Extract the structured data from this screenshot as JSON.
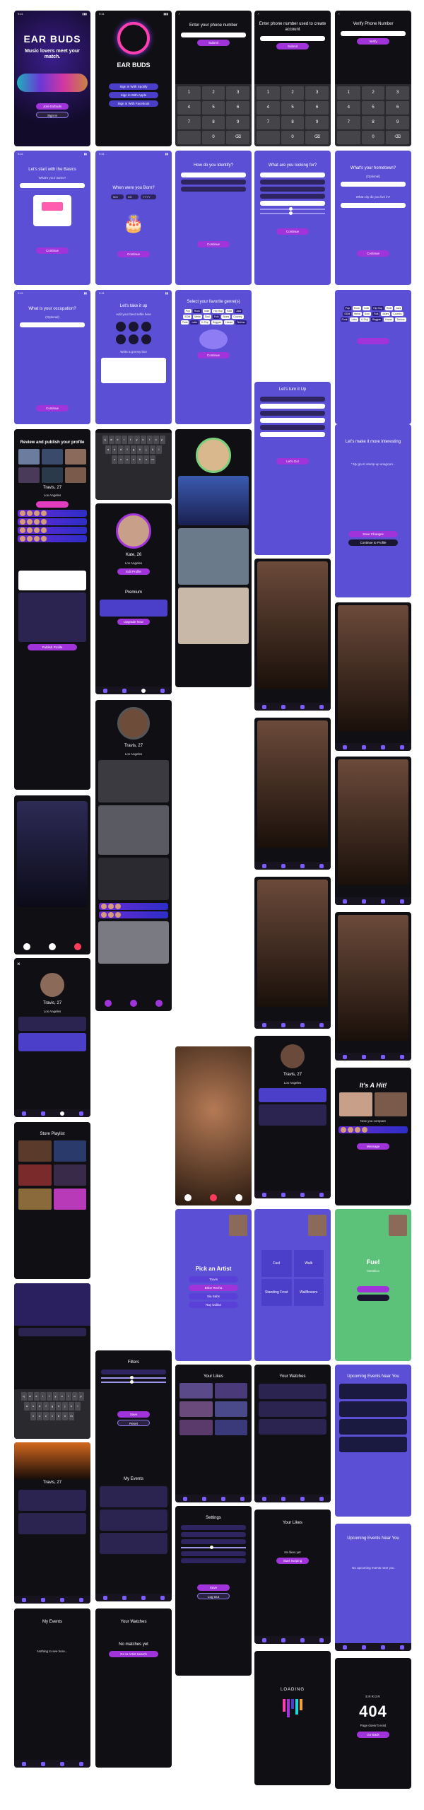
{
  "colors": {
    "brand_purple": "#5b4fd6",
    "accent_magenta": "#a033d9",
    "dark_bg": "#0e0e12",
    "hit_green": "#5cc27a"
  },
  "status_time": "9:41",
  "col1": {
    "splash": {
      "logo": "EAR BUDS",
      "tagline": "Music lovers meet your match.",
      "primary": "Join Earbuds",
      "secondary": "Sign In"
    },
    "basics": {
      "title": "Let's start with the Basics",
      "field": "What's your name?",
      "button": "Continue"
    },
    "occupation": {
      "title": "What is your occupation?",
      "sub": "(Optional)",
      "button": "Continue"
    },
    "review": {
      "title": "Review and publish your profile",
      "name": "Travis, 27",
      "location": "Los Angeles",
      "publish": "Publish Profile"
    },
    "pick_profile": {
      "name": "Travis, 27",
      "location": "Los Angeles"
    },
    "store": {
      "title": "Store Playlist"
    },
    "profile_name": "Travis, 27",
    "events_empty": {
      "title": "My Events",
      "sub": "Nothing to see here..."
    }
  },
  "col2": {
    "logo": {
      "brand": "EAR BUDS",
      "b1": "Sign in With Spotify",
      "b2": "Sign in With Apple",
      "b3": "Sign in With Facebook"
    },
    "dob": {
      "title": "When were you Born?",
      "mm": "MM",
      "dd": "DD",
      "yyyy": "YYYY",
      "button": "Continue"
    },
    "take_pic": {
      "title": "Let's take it up",
      "sub": "Add your best selfie here",
      "bio": "Write a groovy bio!"
    },
    "profile": {
      "name": "Kate, 26",
      "location": "Los Angeles",
      "edit": "Edit Profile",
      "premium": "Premium",
      "upgrade": "Upgrade Now"
    },
    "profile2": {
      "name": "Travis, 27",
      "location": "Los Angeles"
    },
    "filters": {
      "title": "Filters",
      "save": "Save",
      "reset": "Reset"
    },
    "events": {
      "title": "My Events"
    },
    "watches": {
      "title": "Your Watches",
      "empty": "No matches yet",
      "cta": "Go to Artist Search"
    }
  },
  "col3": {
    "phone": {
      "title": "Enter your phone number",
      "button": "Submit"
    },
    "identify": {
      "title": "How do you Identify?",
      "button": "Continue"
    },
    "genres": {
      "title": "Select your favorite genre(s)",
      "button": "Continue"
    },
    "call": {
      "caller": "Travis"
    },
    "pick_artist": {
      "title": "Pick an Artist",
      "a1": "Travis",
      "a2": "Bebe Rexha",
      "a3": "Sia Sabs",
      "a4": "Ray Dollas"
    },
    "likes": {
      "title": "Your Likes"
    },
    "settings": {
      "title": "Settings",
      "save": "Save",
      "logout": "Log Out"
    },
    "genre_chips": [
      "Pop",
      "Rock",
      "Indie",
      "Hip Hop",
      "R&B",
      "Jazz",
      "EDM",
      "Metal",
      "Soul",
      "Folk",
      "Blues",
      "Country",
      "Punk",
      "Latin",
      "K-Pop",
      "Reggae",
      "House",
      "Techno"
    ]
  },
  "col4": {
    "email": {
      "title": "Enter phone number used to create account",
      "button": "Submit"
    },
    "looking": {
      "title": "What are you looking for?",
      "button": "Continue"
    },
    "prefs": {
      "title": "Let's turn it Up",
      "button": "Let's Go!"
    },
    "matches": {
      "label": "Travis, 27",
      "location": "Los Angeles"
    },
    "fuel": {
      "left": "Fuel",
      "right": "Walk",
      "bottom_left": "Standing Frost",
      "bottom_right": "Wallflowers"
    },
    "watches": {
      "title": "Your Watches"
    },
    "likes_empty": {
      "title": "Your Likes",
      "sub": "No likes yet",
      "cta": "Start Swiping"
    },
    "loading": "LOADING"
  },
  "col5": {
    "verify": {
      "title": "Verify Phone Number",
      "button": "Verify"
    },
    "hometown": {
      "title": "What's your hometown?",
      "sub": "(Optional)",
      "city": "What city do you live in?",
      "button": "Continue"
    },
    "lyrics": {
      "title": "Let's make it more interesting",
      "quote": "\" My go-to stump up anagram...",
      "primary": "Save Changes",
      "secondary": "Continue to Profile"
    },
    "hit": {
      "title": "It's A Hit!",
      "sub": "Now you compare",
      "button": "Message"
    },
    "fuel_song": {
      "title": "Fuel",
      "artist": "Metallica"
    },
    "events": {
      "title": "Upcoming Events Near You"
    },
    "events_empty": {
      "title": "Upcoming Events Near You",
      "sub": "No upcoming events near you"
    },
    "error": {
      "label": "ERROR",
      "code": "404",
      "sub": "Page doesn't exist",
      "button": "Go Back"
    }
  }
}
